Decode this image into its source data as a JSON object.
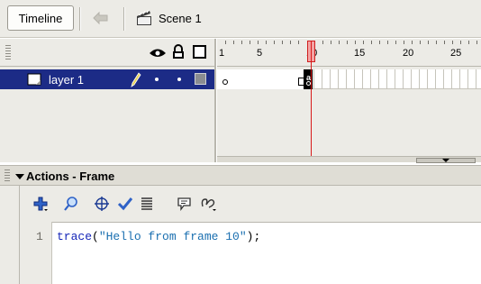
{
  "toolbar": {
    "timeline_tab": "Timeline",
    "scene_label": "Scene 1"
  },
  "timeline": {
    "ruler_labels": [
      "1",
      "5",
      "10",
      "15",
      "20",
      "25"
    ],
    "current_frame": 10,
    "layer": {
      "name": "layer 1"
    },
    "keyframe_marker": "a"
  },
  "actions": {
    "title": "Actions - Frame",
    "tool_icons": [
      "add-statement-icon",
      "find-icon",
      "target-path-icon",
      "check-syntax-icon",
      "auto-format-icon",
      "code-hint-icon",
      "reference-icon"
    ],
    "code": {
      "line_number": "1",
      "fn": "trace",
      "open": "(",
      "string": "\"Hello from frame 10\"",
      "close": ");"
    }
  },
  "colors": {
    "layer_selected": "#1c2b86",
    "playhead": "#d81a1a",
    "code_keyword": "#1526b8",
    "code_string": "#1a6fb0"
  }
}
